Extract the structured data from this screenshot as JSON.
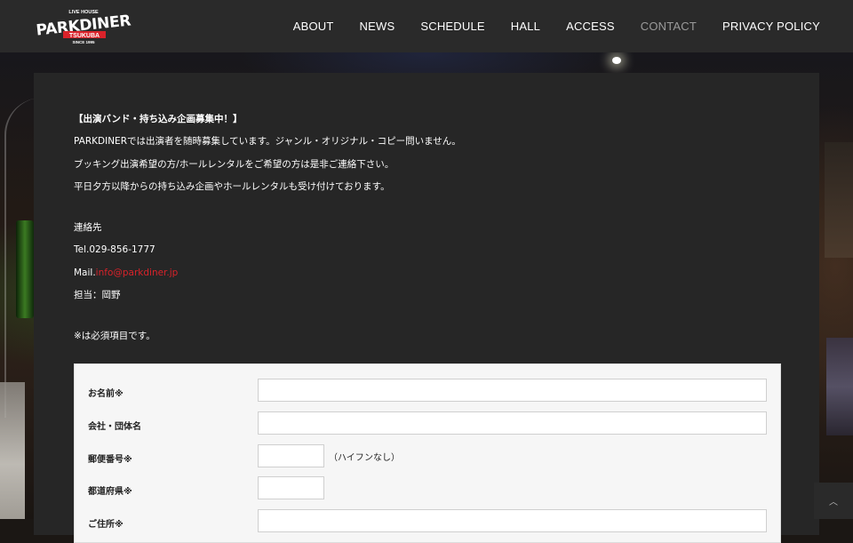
{
  "brand": {
    "top": "LIVE HOUSE",
    "name": "PARKDINER",
    "sub": "TSUKUBA",
    "since": "SINCE 1995"
  },
  "nav": [
    {
      "label": "ABOUT",
      "active": false
    },
    {
      "label": "NEWS",
      "active": false
    },
    {
      "label": "SCHEDULE",
      "active": false
    },
    {
      "label": "HALL",
      "active": false
    },
    {
      "label": "ACCESS",
      "active": false
    },
    {
      "label": "CONTACT",
      "active": true
    },
    {
      "label": "PRIVACY POLICY",
      "active": false
    }
  ],
  "info": {
    "heading": "【出演バンド・持ち込み企画募集中！】",
    "line1": "PARKDINERでは出演者を随時募集しています。ジャンル・オリジナル・コピー問いません。",
    "line2": "ブッキング出演希望の方/ホールレンタルをご希望の方は是非ご連絡下さい。",
    "line3": "平日夕方以降からの持ち込み企画やホールレンタルも受け付けております。",
    "contact_label": "連絡先",
    "tel": "Tel.029-856-1777",
    "mail_prefix": "Mail.",
    "mail": "info@parkdiner.jp",
    "person": "担当：岡野",
    "required_note": "※は必須項目です。"
  },
  "form": {
    "name_label": "お名前※",
    "company_label": "会社・団体名",
    "zip_label": "郵便番号※",
    "zip_note": "（ハイフンなし）",
    "pref_label": "都道府県※",
    "address_label": "ご住所※"
  },
  "colors": {
    "header_bg": "#2a2a2a",
    "panel_bg": "#262626",
    "link_red": "#d9222a",
    "nav_active": "#9b9b9b"
  },
  "icons": {
    "scroll_top": "chevron-up-icon"
  }
}
